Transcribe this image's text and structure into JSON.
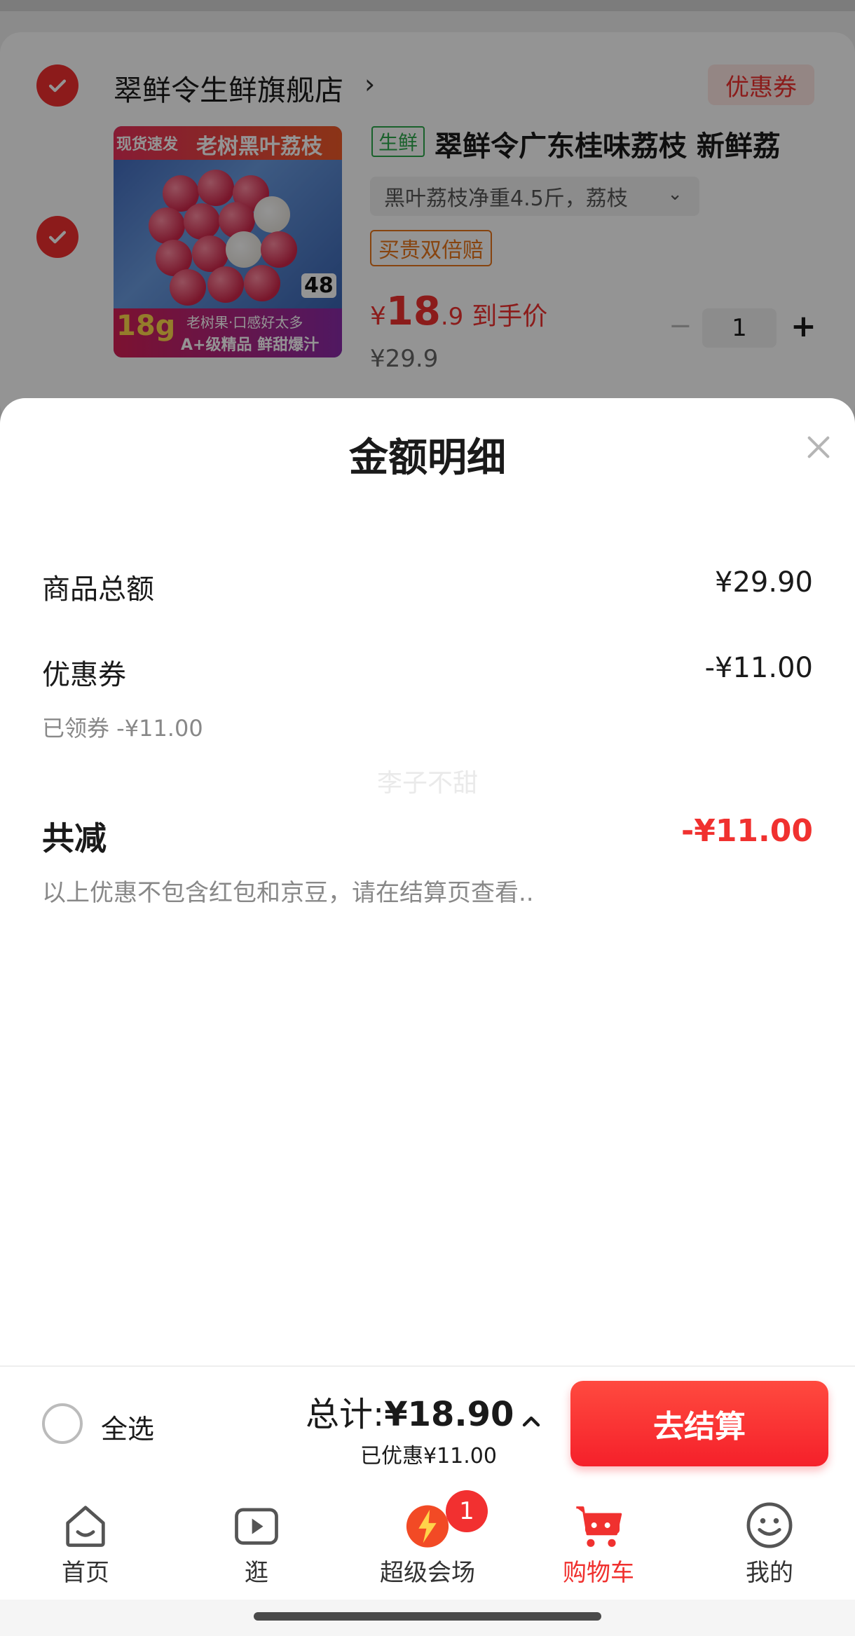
{
  "store": {
    "name": "翠鲜令生鲜旗舰店",
    "coupon_label": "优惠券"
  },
  "product": {
    "tag": "生鲜",
    "title": "翠鲜令广东桂味荔枝 新鲜荔",
    "sku": "黑叶荔枝净重4.5斤，荔枝",
    "guarantee": "买贵双倍赔",
    "price_yen": "¥",
    "price_int": "18",
    "price_dec": ".9",
    "price_note": "到手价",
    "original_price": "¥29.9",
    "quantity": "1",
    "image_texts": {
      "top": "现货速发",
      "headline": "老树黑叶荔枝",
      "weight": "18g",
      "bottom1": "老树果·口感好太多",
      "bottom2": "A+级精品 鲜甜爆汁",
      "speed_badge": "48"
    }
  },
  "sheet": {
    "title": "金额明细",
    "rows": {
      "goods_total_label": "商品总额",
      "goods_total_value": "¥29.90",
      "coupon_label": "优惠券",
      "coupon_value": "-¥11.00",
      "coupon_sub": "已领券 -¥11.00",
      "total_reduce_label": "共减",
      "total_reduce_value": "-¥11.00",
      "note": "以上优惠不包含红包和京豆，请在结算页查看.."
    },
    "watermark": "李子不甜"
  },
  "checkout": {
    "select_all": "全选",
    "total_prefix": "总计:",
    "total_value": "¥18.90",
    "saved": "已优惠¥11.00",
    "button": "去结算"
  },
  "tabs": [
    {
      "label": "首页",
      "icon": "home-icon"
    },
    {
      "label": "逛",
      "icon": "video-icon"
    },
    {
      "label": "超级会场",
      "icon": "super-venue-icon",
      "badge": "1"
    },
    {
      "label": "购物车",
      "icon": "cart-icon",
      "active": true
    },
    {
      "label": "我的",
      "icon": "smiley-icon"
    }
  ],
  "colors": {
    "accent_red": "#f0312f",
    "fresh_green": "#2ba84a",
    "guarantee_orange": "#e8751a"
  }
}
